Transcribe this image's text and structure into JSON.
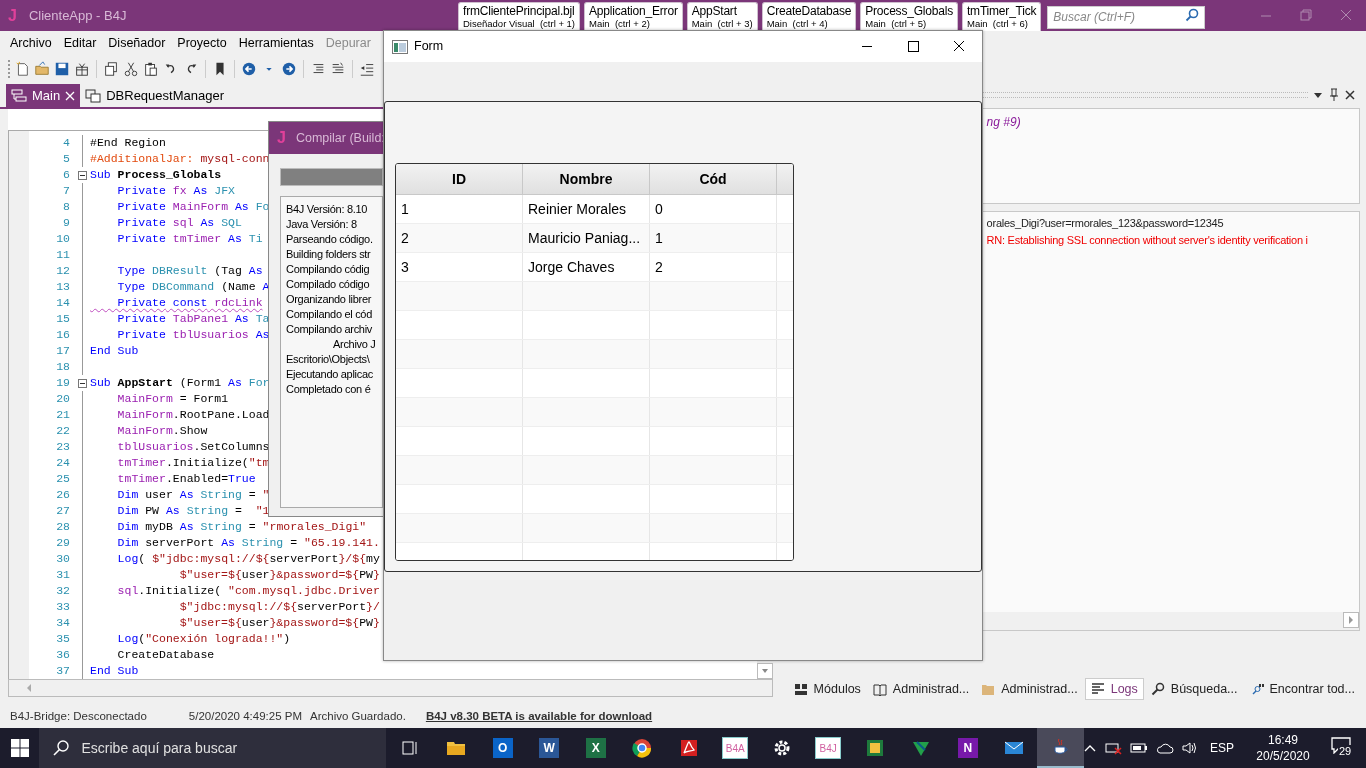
{
  "window": {
    "logo": "J",
    "title": "ClienteApp - B4J"
  },
  "quick_tabs": [
    {
      "title": "frmClientePrincipal.bjl",
      "subtitle": "Diseñador Visual  (ctrl + 1)"
    },
    {
      "title": "Application_Error",
      "subtitle": "Main  (ctrl + 2)"
    },
    {
      "title": "AppStart",
      "subtitle": "Main  (ctrl + 3)"
    },
    {
      "title": "CreateDatabase",
      "subtitle": "Main  (ctrl + 4)"
    },
    {
      "title": "Process_Globals",
      "subtitle": "Main  (ctrl + 5)"
    },
    {
      "title": "tmTimer_Tick",
      "subtitle": "Main  (ctrl + 6)"
    }
  ],
  "search": {
    "placeholder": "Buscar (Ctrl+F)"
  },
  "menu": [
    {
      "label": "Archivo",
      "disabled": false
    },
    {
      "label": "Editar",
      "disabled": false
    },
    {
      "label": "Diseñador",
      "disabled": false
    },
    {
      "label": "Proyecto",
      "disabled": false
    },
    {
      "label": "Herramientas",
      "disabled": false
    },
    {
      "label": "Depurar",
      "disabled": true
    }
  ],
  "editor_tabs": [
    {
      "label": "Main",
      "selected": true
    },
    {
      "label": "DBRequestManager",
      "selected": false
    }
  ],
  "code": [
    {
      "number": "4",
      "fold": false,
      "warning": false,
      "tokens": [
        {
          "kind": "plain",
          "text": "#End Region"
        }
      ]
    },
    {
      "number": "5",
      "fold": false,
      "warning": false,
      "tokens": [
        {
          "kind": "directive",
          "text": "#AdditionalJar:"
        },
        {
          "kind": "string",
          "text": " mysql-conn"
        }
      ]
    },
    {
      "number": "6",
      "fold": true,
      "warning": false,
      "tokens": [
        {
          "kind": "keyword",
          "text": "Sub"
        },
        {
          "kind": "bold",
          "text": " Process_Globals"
        }
      ]
    },
    {
      "number": "7",
      "fold": false,
      "warning": false,
      "tokens": [
        {
          "kind": "keyword",
          "text": "    Private"
        },
        {
          "kind": "variable",
          "text": " fx"
        },
        {
          "kind": "keyword",
          "text": " As"
        },
        {
          "kind": "type",
          "text": " JFX"
        }
      ]
    },
    {
      "number": "8",
      "fold": false,
      "warning": false,
      "tokens": [
        {
          "kind": "keyword",
          "text": "    Private"
        },
        {
          "kind": "variable",
          "text": " MainForm"
        },
        {
          "kind": "keyword",
          "text": " As"
        },
        {
          "kind": "type",
          "text": " Fo"
        }
      ]
    },
    {
      "number": "9",
      "fold": false,
      "warning": false,
      "tokens": [
        {
          "kind": "keyword",
          "text": "    Private"
        },
        {
          "kind": "variable",
          "text": " sql"
        },
        {
          "kind": "keyword",
          "text": " As"
        },
        {
          "kind": "type",
          "text": " SQL"
        }
      ]
    },
    {
      "number": "10",
      "fold": false,
      "warning": false,
      "tokens": [
        {
          "kind": "keyword",
          "text": "    Private"
        },
        {
          "kind": "variable",
          "text": " tmTimer"
        },
        {
          "kind": "keyword",
          "text": " As"
        },
        {
          "kind": "type",
          "text": " Ti"
        }
      ]
    },
    {
      "number": "11",
      "fold": false
    },
    {
      "number": "12",
      "fold": false,
      "warning": false,
      "tokens": [
        {
          "kind": "keyword",
          "text": "    Type"
        },
        {
          "kind": "type",
          "text": " DBResult"
        },
        {
          "kind": "plain",
          "text": " (Tag "
        },
        {
          "kind": "keyword",
          "text": "As"
        }
      ]
    },
    {
      "number": "13",
      "fold": false,
      "warning": false,
      "tokens": [
        {
          "kind": "keyword",
          "text": "    Type"
        },
        {
          "kind": "type",
          "text": " DBCommand"
        },
        {
          "kind": "plain",
          "text": " (Name "
        },
        {
          "kind": "keyword",
          "text": "A"
        }
      ]
    },
    {
      "number": "14",
      "fold": false,
      "warning": true,
      "tokens": [
        {
          "kind": "keyword",
          "text": "    Private"
        },
        {
          "kind": "keyword",
          "text": " const"
        },
        {
          "kind": "variable",
          "text": " rdcLink"
        }
      ]
    },
    {
      "number": "15",
      "fold": false,
      "warning": false,
      "tokens": [
        {
          "kind": "keyword",
          "text": "    Private"
        },
        {
          "kind": "variable",
          "text": " TabPane1"
        },
        {
          "kind": "keyword",
          "text": " As"
        },
        {
          "kind": "type",
          "text": " Ta"
        }
      ]
    },
    {
      "number": "16",
      "fold": false,
      "warning": false,
      "tokens": [
        {
          "kind": "keyword",
          "text": "    Private"
        },
        {
          "kind": "variable",
          "text": " tblUsuarios"
        },
        {
          "kind": "keyword",
          "text": " As"
        }
      ]
    },
    {
      "number": "17",
      "fold": false,
      "warning": false,
      "tokens": [
        {
          "kind": "keyword",
          "text": "End Sub"
        }
      ]
    },
    {
      "number": "18",
      "fold": false
    },
    {
      "number": "19",
      "fold": true,
      "warning": false,
      "tokens": [
        {
          "kind": "keyword",
          "text": "Sub"
        },
        {
          "kind": "bold",
          "text": " AppStart"
        },
        {
          "kind": "plain",
          "text": " (Form1 "
        },
        {
          "kind": "keyword",
          "text": "As"
        },
        {
          "kind": "type",
          "text": " For"
        }
      ]
    },
    {
      "number": "20",
      "fold": false,
      "warning": false,
      "tokens": [
        {
          "kind": "variable",
          "text": "    MainForm"
        },
        {
          "kind": "plain",
          "text": " = Form1"
        }
      ]
    },
    {
      "number": "21",
      "fold": false,
      "warning": false,
      "tokens": [
        {
          "kind": "variable",
          "text": "    MainForm"
        },
        {
          "kind": "plain",
          "text": ".RootPane.Load"
        }
      ]
    },
    {
      "number": "22",
      "fold": false,
      "warning": false,
      "tokens": [
        {
          "kind": "variable",
          "text": "    MainForm"
        },
        {
          "kind": "plain",
          "text": ".Show"
        }
      ]
    },
    {
      "number": "23",
      "fold": false,
      "warning": false,
      "tokens": [
        {
          "kind": "variable",
          "text": "    tblUsuarios"
        },
        {
          "kind": "plain",
          "text": ".SetColumns"
        }
      ]
    },
    {
      "number": "24",
      "fold": false,
      "warning": false,
      "tokens": [
        {
          "kind": "variable",
          "text": "    tmTimer"
        },
        {
          "kind": "plain",
          "text": ".Initialize("
        },
        {
          "kind": "string",
          "text": "\"tm"
        }
      ]
    },
    {
      "number": "25",
      "fold": false,
      "warning": false,
      "tokens": [
        {
          "kind": "variable",
          "text": "    tmTimer"
        },
        {
          "kind": "plain",
          "text": ".Enabled="
        },
        {
          "kind": "keyword",
          "text": "True"
        }
      ]
    },
    {
      "number": "26",
      "fold": false,
      "warning": false,
      "tokens": [
        {
          "kind": "keyword",
          "text": "    Dim"
        },
        {
          "kind": "plain",
          "text": " user "
        },
        {
          "kind": "keyword",
          "text": "As"
        },
        {
          "kind": "type",
          "text": " String"
        },
        {
          "kind": "plain",
          "text": " = "
        },
        {
          "kind": "string",
          "text": "\""
        }
      ]
    },
    {
      "number": "27",
      "fold": false,
      "warning": false,
      "tokens": [
        {
          "kind": "keyword",
          "text": "    Dim"
        },
        {
          "kind": "plain",
          "text": " PW "
        },
        {
          "kind": "keyword",
          "text": "As"
        },
        {
          "kind": "type",
          "text": " String"
        },
        {
          "kind": "plain",
          "text": " =  "
        },
        {
          "kind": "string",
          "text": "\"1"
        }
      ]
    },
    {
      "number": "28",
      "fold": false,
      "warning": false,
      "tokens": [
        {
          "kind": "keyword",
          "text": "    Dim"
        },
        {
          "kind": "plain",
          "text": " myDB "
        },
        {
          "kind": "keyword",
          "text": "As"
        },
        {
          "kind": "type",
          "text": " String"
        },
        {
          "kind": "plain",
          "text": " = "
        },
        {
          "kind": "string",
          "text": "\"rmorales_Digi\""
        }
      ]
    },
    {
      "number": "29",
      "fold": false,
      "warning": false,
      "tokens": [
        {
          "kind": "keyword",
          "text": "    Dim"
        },
        {
          "kind": "plain",
          "text": " serverPort "
        },
        {
          "kind": "keyword",
          "text": "As"
        },
        {
          "kind": "type",
          "text": " String"
        },
        {
          "kind": "plain",
          "text": " = "
        },
        {
          "kind": "string",
          "text": "\"65.19.141."
        }
      ]
    },
    {
      "number": "30",
      "fold": false,
      "warning": false,
      "tokens": [
        {
          "kind": "keyword",
          "text": "    Log"
        },
        {
          "kind": "plain",
          "text": "( "
        },
        {
          "kind": "string",
          "text": "$\"jdbc:mysql://${"
        },
        {
          "kind": "plain",
          "text": "serverPort"
        },
        {
          "kind": "string",
          "text": "}/${"
        },
        {
          "kind": "plain",
          "text": "my"
        }
      ]
    },
    {
      "number": "31",
      "fold": false,
      "warning": false,
      "tokens": [
        {
          "kind": "string",
          "text": "             $\"user=${"
        },
        {
          "kind": "plain",
          "text": "user"
        },
        {
          "kind": "string",
          "text": "}&password=${"
        },
        {
          "kind": "plain",
          "text": "PW"
        },
        {
          "kind": "string",
          "text": "}"
        }
      ]
    },
    {
      "number": "32",
      "fold": false,
      "warning": false,
      "tokens": [
        {
          "kind": "variable",
          "text": "    sql"
        },
        {
          "kind": "plain",
          "text": ".Initialize( "
        },
        {
          "kind": "string",
          "text": "\"com.mysql.jdbc.Driver"
        }
      ]
    },
    {
      "number": "33",
      "fold": false,
      "warning": false,
      "tokens": [
        {
          "kind": "string",
          "text": "             $\"jdbc:mysql://${"
        },
        {
          "kind": "plain",
          "text": "serverPort"
        },
        {
          "kind": "string",
          "text": "}/"
        }
      ]
    },
    {
      "number": "34",
      "fold": false,
      "warning": false,
      "tokens": [
        {
          "kind": "string",
          "text": "             $\"user=${"
        },
        {
          "kind": "plain",
          "text": "user"
        },
        {
          "kind": "string",
          "text": "}&password=${"
        },
        {
          "kind": "plain",
          "text": "PW"
        },
        {
          "kind": "string",
          "text": "}"
        }
      ]
    },
    {
      "number": "35",
      "fold": false,
      "warning": false,
      "tokens": [
        {
          "kind": "keyword",
          "text": "    Log"
        },
        {
          "kind": "plain",
          "text": "("
        },
        {
          "kind": "string",
          "text": "\"Conexión lograda!!\""
        },
        {
          "kind": "plain",
          "text": ")"
        }
      ]
    },
    {
      "number": "36",
      "fold": false,
      "warning": false,
      "tokens": [
        {
          "kind": "plain",
          "text": "    CreateDatabase"
        }
      ]
    },
    {
      "number": "37",
      "fold": false,
      "warning": false,
      "tokens": [
        {
          "kind": "keyword",
          "text": "End Sub"
        }
      ]
    }
  ],
  "compile_dialog": {
    "logo": "J",
    "title": "Compilar (Build:",
    "progress": {
      "level": 1
    },
    "log": [
      {
        "text": "B4J Versión: 8.10",
        "indented": false
      },
      {
        "text": "Java Versión: 8",
        "indented": false
      },
      {
        "text": "Parseando código.",
        "indented": false
      },
      {
        "text": "Building folders str",
        "indented": false
      },
      {
        "text": "Compilando códig",
        "indented": false
      },
      {
        "text": "Compilado código",
        "indented": false
      },
      {
        "text": "Organizando librer",
        "indented": false
      },
      {
        "text": "Compilando el cód",
        "indented": false
      },
      {
        "text": "Compilando archiv",
        "indented": false
      },
      {
        "text": "Archivo J",
        "indented": true
      },
      {
        "text": "Escritorio\\Objects\\",
        "indented": false
      },
      {
        "text": "Ejecutando aplicac",
        "indented": false
      },
      {
        "text": "Completado con é",
        "indented": false
      }
    ]
  },
  "form_window": {
    "title": "Form",
    "table": {
      "columns": [
        "ID",
        "Nombre",
        "Cód"
      ],
      "rows": [
        [
          "1",
          "Reinier Morales",
          "0"
        ],
        [
          "2",
          "Mauricio Paniag...",
          "1"
        ],
        [
          "3",
          "Jorge Chaves",
          "2"
        ]
      ]
    }
  },
  "right_panel": {
    "info_text": "ng #9)",
    "logs": [
      {
        "kind": "info",
        "text": "orales_Digi?user=rmorales_123&password=12345"
      },
      {
        "kind": "warning",
        "text": "RN: Establishing SSL connection without server's identity verification i"
      }
    ]
  },
  "panel_tabs": [
    {
      "kind": "modules",
      "label": "Módulos",
      "selected": false
    },
    {
      "kind": "book",
      "label": "Administrad...",
      "selected": false
    },
    {
      "kind": "folder",
      "label": "Administrad...",
      "selected": false
    },
    {
      "kind": "logs",
      "label": "Logs",
      "selected": true
    },
    {
      "kind": "search",
      "label": "Búsqueda...",
      "selected": false
    },
    {
      "kind": "find",
      "label": "Encontrar tod...",
      "selected": false
    }
  ],
  "status_bar": {
    "bridge": "B4J-Bridge: Desconectado",
    "timestamp": "5/20/2020 4:49:25 PM",
    "message": "Archivo Guardado.",
    "update_link": "B4J v8.30 BETA is available for download"
  },
  "taskbar": {
    "search_placeholder": "Escribe aquí para buscar",
    "apps": [
      {
        "kind": "taskview",
        "active": false
      },
      {
        "kind": "explorer",
        "active": false
      },
      {
        "kind": "outlook",
        "label": "O",
        "active": false
      },
      {
        "kind": "word",
        "label": "W",
        "active": false
      },
      {
        "kind": "excel",
        "label": "X",
        "active": false
      },
      {
        "kind": "chrome",
        "active": false
      },
      {
        "kind": "acrobat",
        "active": false
      },
      {
        "kind": "textapp",
        "label": "B4A",
        "active": false
      },
      {
        "kind": "settings",
        "active": false
      },
      {
        "kind": "textapp",
        "label": "B4J",
        "active": false
      },
      {
        "kind": "photo",
        "active": false
      },
      {
        "kind": "leaf",
        "active": false
      },
      {
        "kind": "onenote",
        "label": "N",
        "active": false
      },
      {
        "kind": "mail",
        "active": false
      },
      {
        "kind": "java",
        "active": true
      }
    ]
  },
  "tray": {
    "language": "ESP",
    "time": "16:49",
    "date": "20/5/2020",
    "notifications": "29"
  }
}
